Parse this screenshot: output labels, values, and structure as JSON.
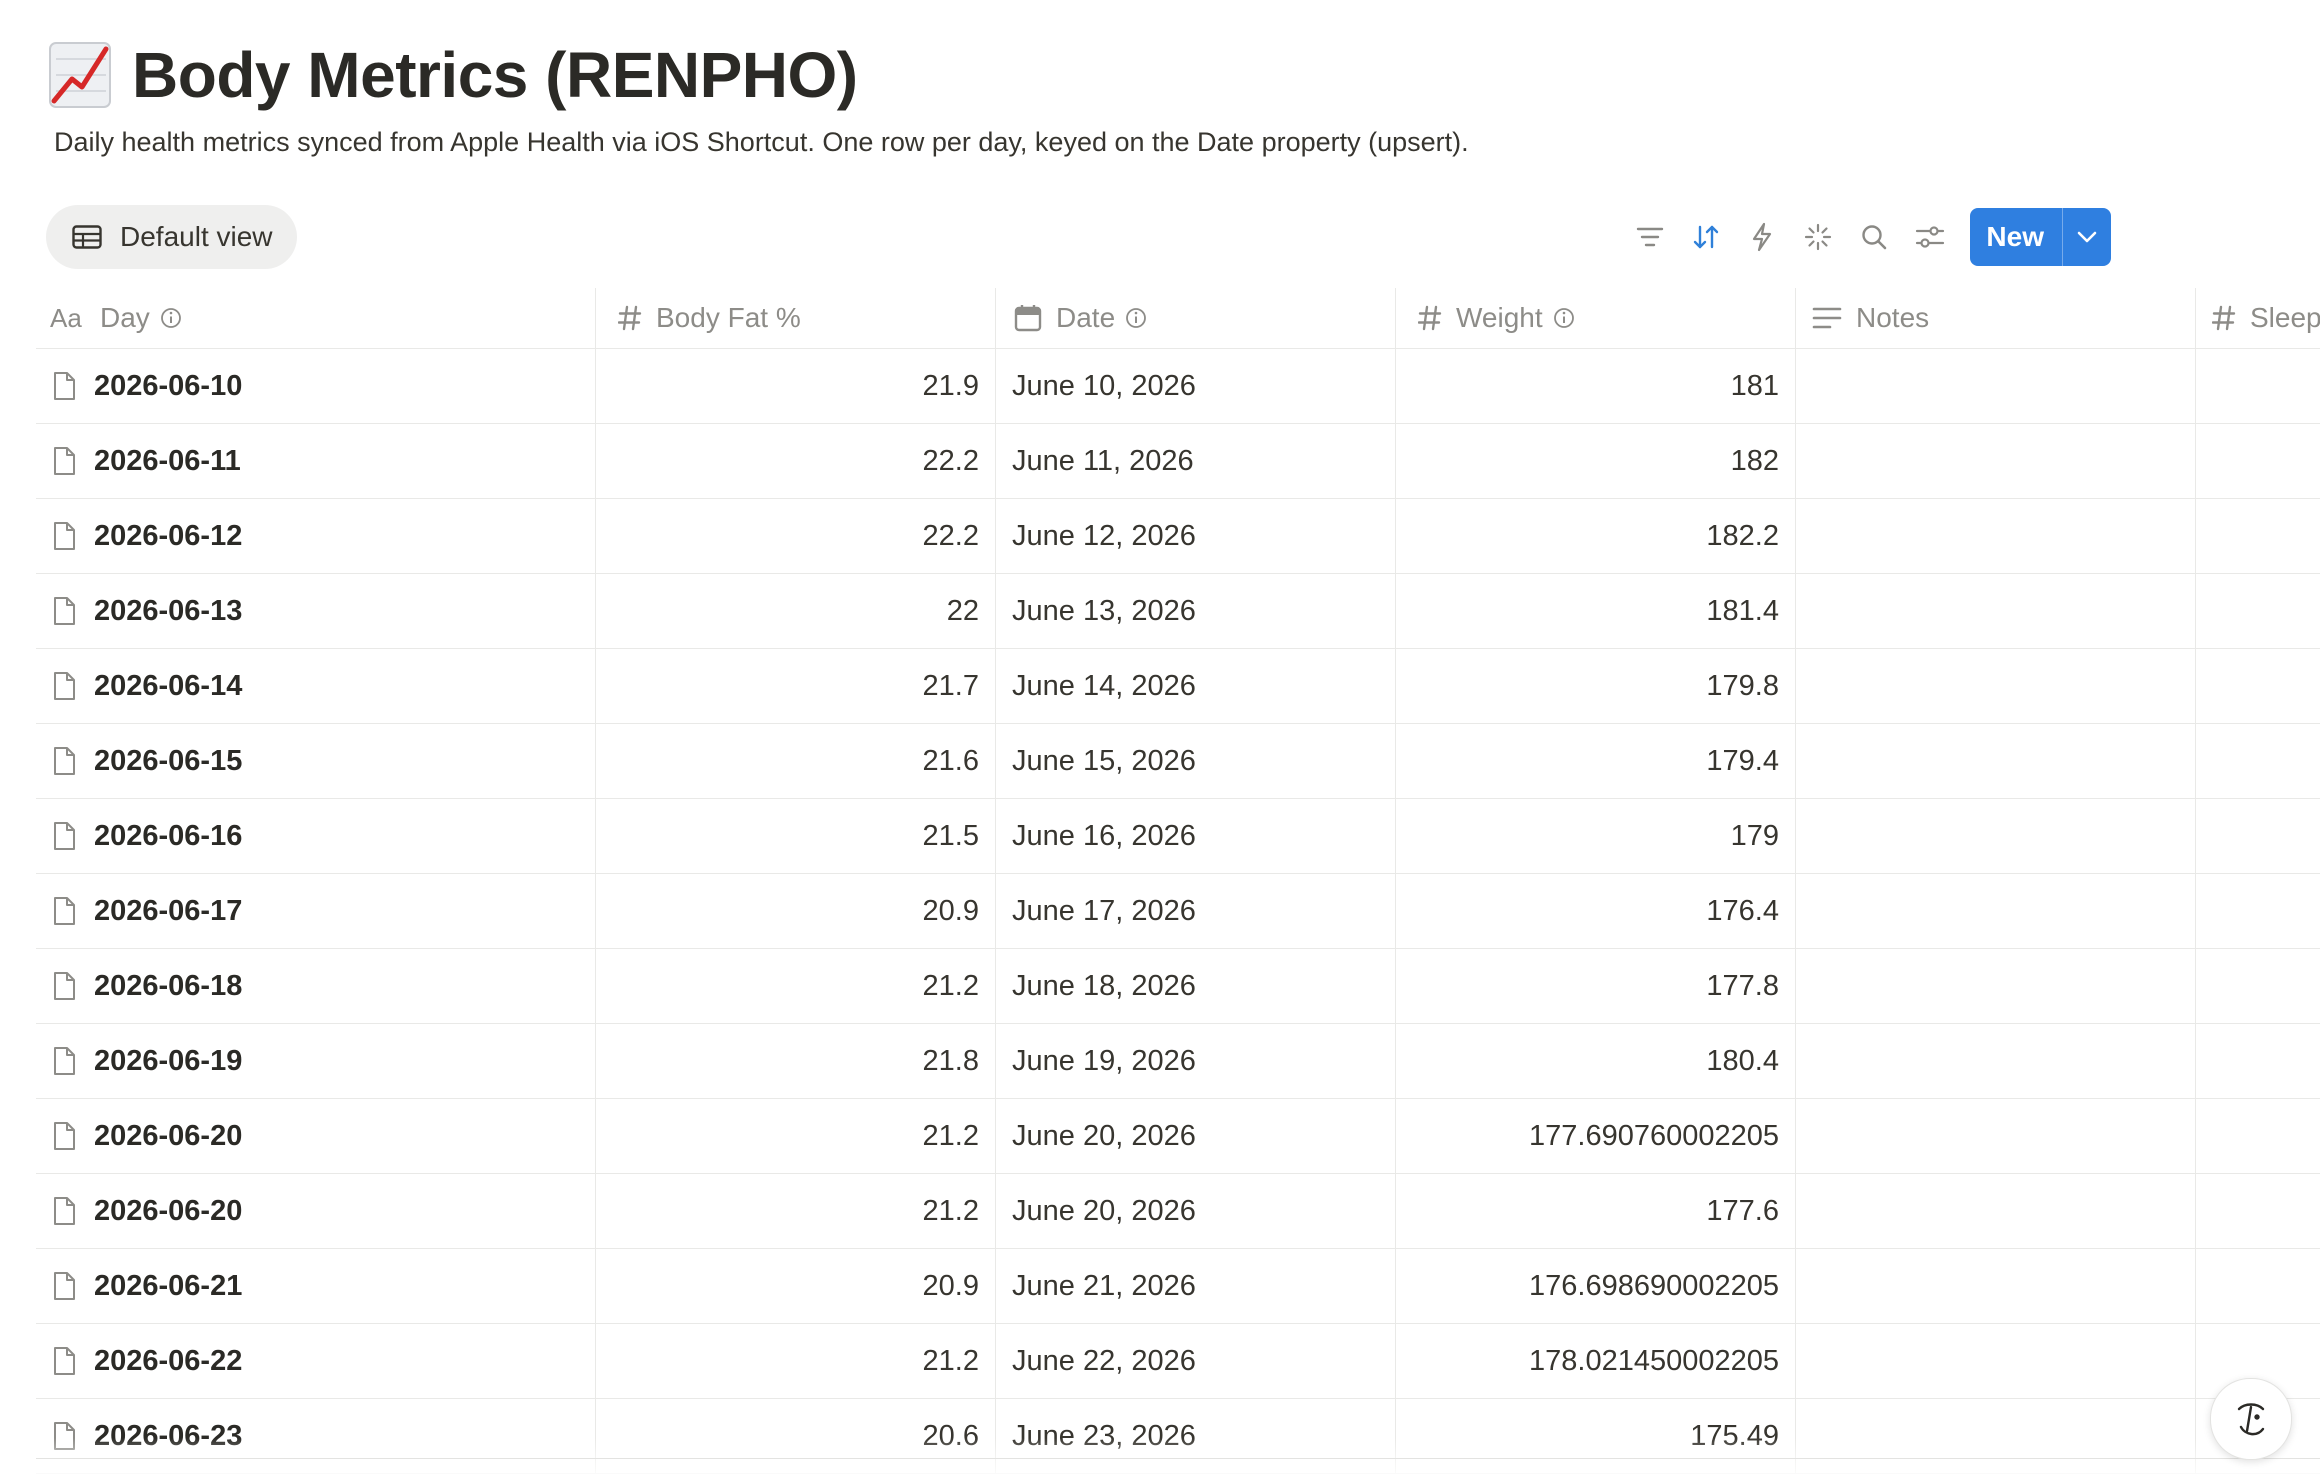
{
  "page": {
    "title": "Body Metrics (RENPHO)",
    "title_icon": "chart-increasing-emoji",
    "description": "Daily health metrics synced from Apple Health via iOS Shortcut. One row per day, keyed on the Date property (upsert)."
  },
  "view": {
    "label": "Default view",
    "icon": "table-icon"
  },
  "toolbar": {
    "tools": [
      "filter-icon",
      "sort-icon",
      "automation-icon",
      "ai-sparkle-icon",
      "search-icon",
      "settings-sliders-icon"
    ],
    "active_tool": "sort-icon",
    "new_label": "New",
    "accent_color": "#2f7fe0"
  },
  "columns": {
    "day": "Day",
    "body_fat": "Body Fat %",
    "date": "Date",
    "weight": "Weight",
    "notes": "Notes",
    "sleep": "Sleep"
  },
  "rows": [
    {
      "day": "2026-06-10",
      "body_fat": "21.9",
      "date": "June 10, 2026",
      "weight": "181",
      "notes": ""
    },
    {
      "day": "2026-06-11",
      "body_fat": "22.2",
      "date": "June 11, 2026",
      "weight": "182",
      "notes": ""
    },
    {
      "day": "2026-06-12",
      "body_fat": "22.2",
      "date": "June 12, 2026",
      "weight": "182.2",
      "notes": ""
    },
    {
      "day": "2026-06-13",
      "body_fat": "22",
      "date": "June 13, 2026",
      "weight": "181.4",
      "notes": ""
    },
    {
      "day": "2026-06-14",
      "body_fat": "21.7",
      "date": "June 14, 2026",
      "weight": "179.8",
      "notes": ""
    },
    {
      "day": "2026-06-15",
      "body_fat": "21.6",
      "date": "June 15, 2026",
      "weight": "179.4",
      "notes": ""
    },
    {
      "day": "2026-06-16",
      "body_fat": "21.5",
      "date": "June 16, 2026",
      "weight": "179",
      "notes": ""
    },
    {
      "day": "2026-06-17",
      "body_fat": "20.9",
      "date": "June 17, 2026",
      "weight": "176.4",
      "notes": ""
    },
    {
      "day": "2026-06-18",
      "body_fat": "21.2",
      "date": "June 18, 2026",
      "weight": "177.8",
      "notes": ""
    },
    {
      "day": "2026-06-19",
      "body_fat": "21.8",
      "date": "June 19, 2026",
      "weight": "180.4",
      "notes": ""
    },
    {
      "day": "2026-06-20",
      "body_fat": "21.2",
      "date": "June 20, 2026",
      "weight": "177.690760002205",
      "notes": ""
    },
    {
      "day": "2026-06-20",
      "body_fat": "21.2",
      "date": "June 20, 2026",
      "weight": "177.6",
      "notes": ""
    },
    {
      "day": "2026-06-21",
      "body_fat": "20.9",
      "date": "June 21, 2026",
      "weight": "176.698690002205",
      "notes": ""
    },
    {
      "day": "2026-06-22",
      "body_fat": "21.2",
      "date": "June 22, 2026",
      "weight": "178.021450002205",
      "notes": ""
    },
    {
      "day": "2026-06-23",
      "body_fat": "20.6",
      "date": "June 23, 2026",
      "weight": "175.49",
      "notes": ""
    }
  ],
  "help_button": {
    "icon": "notion-ai-face-icon"
  }
}
